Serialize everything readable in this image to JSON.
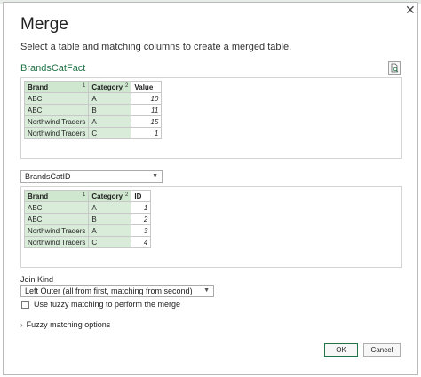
{
  "dialog": {
    "title": "Merge",
    "subtitle": "Select a table and matching columns to create a merged table.",
    "close_glyph": "✕"
  },
  "first_table": {
    "name": "BrandsCatFact",
    "headers": [
      {
        "label": "Brand",
        "order": "1"
      },
      {
        "label": "Category",
        "order": "2"
      },
      {
        "label": "Value",
        "order": ""
      }
    ],
    "rows": [
      [
        "ABC",
        "A",
        "10"
      ],
      [
        "ABC",
        "B",
        "11"
      ],
      [
        "Northwind Traders",
        "A",
        "15"
      ],
      [
        "Northwind Traders",
        "C",
        "1"
      ]
    ]
  },
  "second_table": {
    "selected": "BrandsCatID",
    "headers": [
      {
        "label": "Brand",
        "order": "1"
      },
      {
        "label": "Category",
        "order": "2"
      },
      {
        "label": "ID",
        "order": ""
      }
    ],
    "rows": [
      [
        "ABC",
        "A",
        "1"
      ],
      [
        "ABC",
        "B",
        "2"
      ],
      [
        "Northwind Traders",
        "A",
        "3"
      ],
      [
        "Northwind Traders",
        "C",
        "4"
      ]
    ]
  },
  "join": {
    "label": "Join Kind",
    "selected": "Left Outer (all from first, matching from second)"
  },
  "fuzzy_checkbox_label": "Use fuzzy matching to perform the merge",
  "fuzzy_options_label": "Fuzzy matching options",
  "buttons": {
    "ok": "OK",
    "cancel": "Cancel"
  },
  "icons": {
    "dropdown": "chevron-down-icon",
    "expand": "chevron-right-icon",
    "preview": "document-preview-icon"
  },
  "colors": {
    "accent": "#217346",
    "selected_column": "#d9ecd9"
  }
}
